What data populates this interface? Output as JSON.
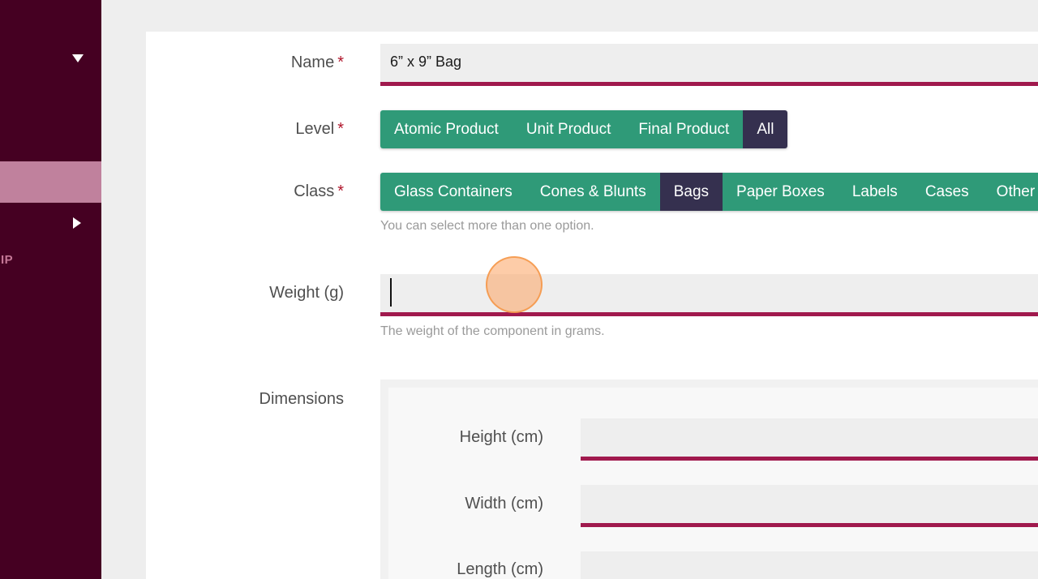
{
  "sidebar": {
    "collapse_icon": "caret-down-icon",
    "expand_icon": "caret-right-icon",
    "partial_label": "IP"
  },
  "form": {
    "name": {
      "label": "Name",
      "required_mark": "*",
      "value": "6” x 9” Bag"
    },
    "level": {
      "label": "Level",
      "required_mark": "*",
      "options": [
        "Atomic Product",
        "Unit Product",
        "Final Product",
        "All"
      ],
      "selected": "All"
    },
    "class": {
      "label": "Class",
      "required_mark": "*",
      "options": [
        "Glass Containers",
        "Cones & Blunts",
        "Bags",
        "Paper Boxes",
        "Labels",
        "Cases",
        "Other"
      ],
      "selected": "Bags",
      "hint": "You can select more than one option."
    },
    "weight": {
      "label": "Weight (g)",
      "value": "",
      "hint": "The weight of the component in grams."
    },
    "dimensions": {
      "label": "Dimensions",
      "height_label": "Height (cm)",
      "width_label": "Width (cm)",
      "length_label": "Length (cm)"
    }
  },
  "colors": {
    "sidebar_bg": "#450022",
    "accent_underline": "#a0194d",
    "segment_green": "#2f9a78",
    "segment_active": "#35304f",
    "required_red": "#b0152b"
  }
}
